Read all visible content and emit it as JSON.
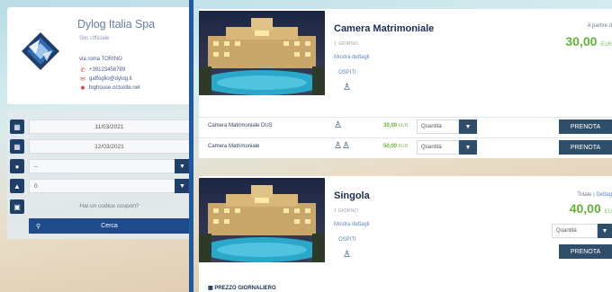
{
  "company": {
    "name": "Dylog Italia Spa",
    "subtitle": "Sito Ufficiale",
    "address": "via roma TORINO",
    "phone": "+39123456789",
    "email": "gaffoglio@dylog.it",
    "website": "bighouse.octsolte.net"
  },
  "search_form": {
    "date_from": "11/03/2021",
    "date_to": "12/03/2021",
    "adults_value": "–",
    "children_value": "0",
    "coupon_text": "Hai un codice coupon?",
    "search_label": "Cerca"
  },
  "results": [
    {
      "title": "Camera Matrimoniale",
      "subtitle": "1 GIORNO",
      "details_link": "Mostra dettagli",
      "guests_label": "OSPITI",
      "price_prefix": "A partire d",
      "price": "30,00",
      "price_currency": "EUR",
      "rates": [
        {
          "name": "Camera Matrimoniale DUS",
          "price": "30,00",
          "currency": "EUR",
          "qty_label": "Quantità",
          "book_label": "PRENOTA"
        },
        {
          "name": "Camera Matrimoniale",
          "price": "50,00",
          "currency": "EUR",
          "qty_label": "Quantità",
          "book_label": "PRENOTA"
        }
      ]
    },
    {
      "title": "Singola",
      "subtitle": "1 GIORNO",
      "details_link": "Mostra dettagli",
      "guests_label": "OSPITI",
      "total_prefix": "Totale | ",
      "total_link": "Dettag",
      "price": "40,00",
      "price_currency": "EU",
      "qty_label": "Quantità",
      "book_label": "PRENOTA",
      "daily_price_label": "PREZZO GIORNALIERO"
    }
  ],
  "icons": {
    "calendar": "calendar-icon",
    "adult": "adult-icon",
    "child": "child-icon",
    "coupon": "ticket-icon",
    "search": "search-icon",
    "chevron": "chevron-down-icon",
    "person": "person-icon",
    "phone": "phone-icon",
    "mail": "mail-icon",
    "web": "web-icon",
    "location": "location-icon"
  },
  "colors": {
    "primary_navy": "#1f3f68",
    "accent_blue": "#1f5aa0",
    "price_green": "#67b23a",
    "button_slate": "#2e4e6a"
  }
}
